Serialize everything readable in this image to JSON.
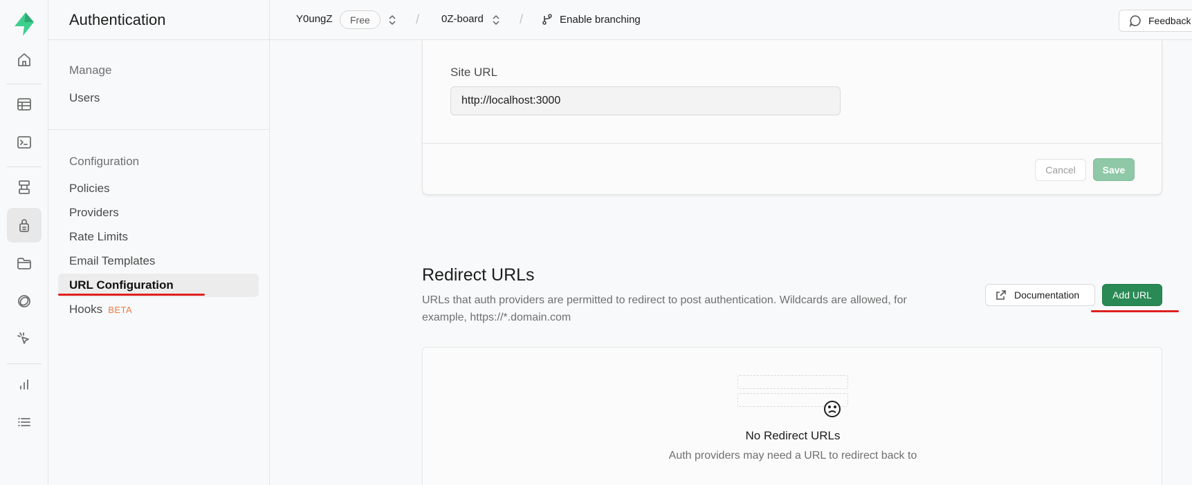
{
  "sidebar": {
    "title": "Authentication",
    "groups": [
      {
        "label": "Manage",
        "items": [
          "Users"
        ]
      },
      {
        "label": "Configuration",
        "items": [
          "Policies",
          "Providers",
          "Rate Limits",
          "Email Templates",
          "URL Configuration",
          "Hooks"
        ]
      }
    ],
    "active_item": "URL Configuration",
    "hooks_badge": "BETA"
  },
  "topbar": {
    "org": "Y0ungZ",
    "plan": "Free",
    "project": "0Z-board",
    "branching": "Enable branching",
    "feedback": "Feedback"
  },
  "site_url": {
    "label": "Site URL",
    "value": "http://localhost:3000",
    "cancel": "Cancel",
    "save": "Save"
  },
  "redirect": {
    "title": "Redirect URLs",
    "description": "URLs that auth providers are permitted to redirect to post authentication. Wildcards are allowed, for example, https://*.domain.com",
    "documentation": "Documentation",
    "add_url": "Add URL",
    "empty_title": "No Redirect URLs",
    "empty_subtitle": "Auth providers may need a URL to redirect back to"
  },
  "colors": {
    "brand_green": "#3ecf8e",
    "primary_button": "#2a8a55",
    "annotation_red": "#e0201f",
    "beta_orange": "#f07b3f"
  },
  "icons": {
    "rail": [
      "home-icon",
      "table-editor-icon",
      "sql-editor-icon",
      "database-icon",
      "auth-icon",
      "storage-icon",
      "realtime-icon",
      "edge-functions-icon",
      "reports-icon",
      "logs-icon"
    ]
  }
}
